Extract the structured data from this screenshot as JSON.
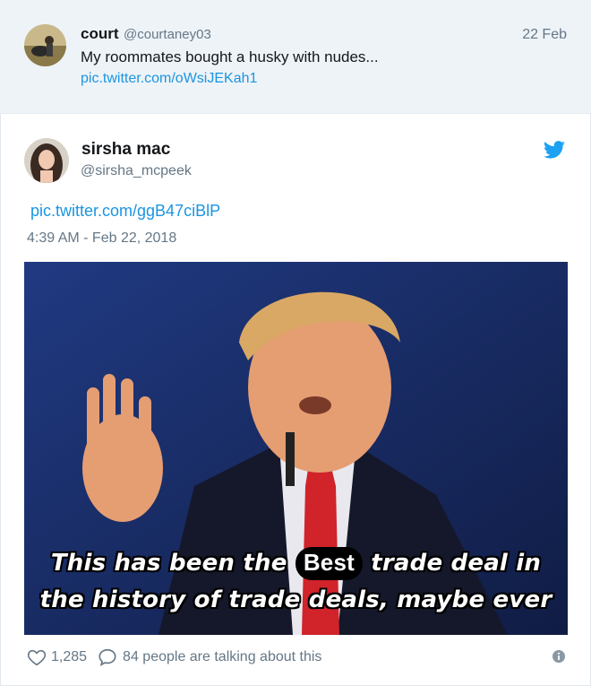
{
  "parent_tweet": {
    "name": "court",
    "handle": "@courtaney03",
    "date": "22 Feb",
    "text": "My roommates bought a husky with nudes...",
    "link": "pic.twitter.com/oWsiJEKah1"
  },
  "tweet": {
    "name": "sirsha mac",
    "handle": "@sirsha_mcpeek",
    "link": "pic.twitter.com/ggB47ciBlP",
    "timestamp": "4:39 AM - Feb 22, 2018",
    "media": {
      "caption_line1_before": "This has been the",
      "caption_highlight": "Best",
      "caption_line1_after": "trade deal in",
      "caption_line2": "the history of trade deals, maybe ever"
    },
    "likes": "1,285",
    "talking": "84 people are talking about this"
  },
  "icons": {
    "heart": "heart-icon",
    "reply": "reply-icon",
    "info": "info-icon",
    "bird": "twitter-bird-icon"
  },
  "colors": {
    "link": "#1b95e0",
    "secondary_text": "#657786",
    "parent_bg": "#eef3f8",
    "twitter_blue": "#1da1f2"
  }
}
